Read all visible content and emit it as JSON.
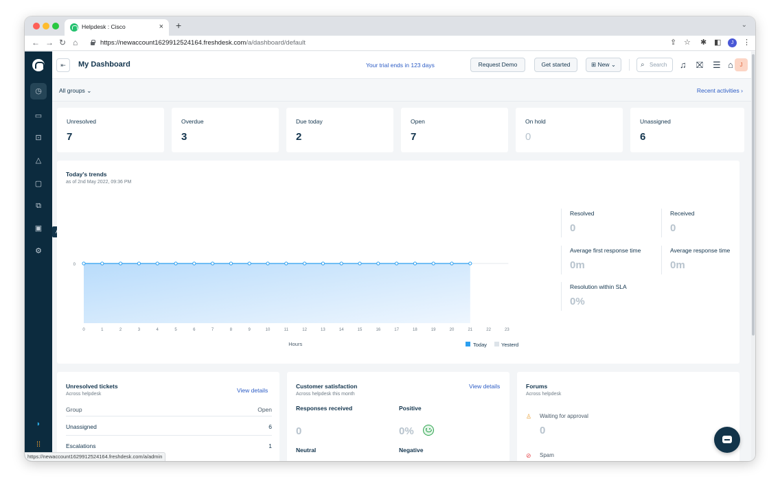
{
  "browser": {
    "tab_title": "Helpdesk : Cisco",
    "tab_close": "×",
    "new_tab": "+",
    "url_host": "https://newaccount1629912524164.freshdesk.com",
    "url_path": "/a/dashboard/default",
    "status_url": "https://newaccount1629912524164.freshdesk.com/a/admin",
    "profile_initial": "J"
  },
  "nav": {
    "tooltip": "Admin"
  },
  "topbar": {
    "title": "My Dashboard",
    "trial": "Your trial ends in 123 days",
    "request_demo": "Request Demo",
    "get_started": "Get started",
    "new": "New",
    "search": "Search",
    "avatar_initial": "J"
  },
  "filter": {
    "groups": "All groups",
    "recent": "Recent activities"
  },
  "stats": [
    {
      "label": "Unresolved",
      "value": "7"
    },
    {
      "label": "Overdue",
      "value": "3"
    },
    {
      "label": "Due today",
      "value": "2"
    },
    {
      "label": "Open",
      "value": "7"
    },
    {
      "label": "On hold",
      "value": "0"
    },
    {
      "label": "Unassigned",
      "value": "6"
    }
  ],
  "trends": {
    "title": "Today's trends",
    "subtitle": "as of 2nd May 2022, 09:36 PM",
    "metrics": [
      {
        "label": "Resolved",
        "value": "0"
      },
      {
        "label": "Received",
        "value": "0"
      },
      {
        "label": "Average first response time",
        "value": "0m"
      },
      {
        "label": "Average response time",
        "value": "0m"
      },
      {
        "label": "Resolution within SLA",
        "value": "0%"
      }
    ]
  },
  "chart_data": {
    "type": "area",
    "x": [
      0,
      1,
      2,
      3,
      4,
      5,
      6,
      7,
      8,
      9,
      10,
      11,
      12,
      13,
      14,
      15,
      16,
      17,
      18,
      19,
      20,
      21,
      22,
      23
    ],
    "series": [
      {
        "name": "Today",
        "x": [
          0,
          1,
          2,
          3,
          4,
          5,
          6,
          7,
          8,
          9,
          10,
          11,
          12,
          13,
          14,
          15,
          16,
          17,
          18,
          19,
          20,
          21
        ],
        "values": [
          0,
          0,
          0,
          0,
          0,
          0,
          0,
          0,
          0,
          0,
          0,
          0,
          0,
          0,
          0,
          0,
          0,
          0,
          0,
          0,
          0,
          0
        ]
      },
      {
        "name": "Yesterday",
        "x": [
          0,
          1,
          2,
          3,
          4,
          5,
          6,
          7,
          8,
          9,
          10,
          11,
          12,
          13,
          14,
          15,
          16,
          17,
          18,
          19,
          20,
          21,
          22,
          23
        ],
        "values": [
          0,
          0,
          0,
          0,
          0,
          0,
          0,
          0,
          0,
          0,
          0,
          0,
          0,
          0,
          0,
          0,
          0,
          0,
          0,
          0,
          0,
          0,
          0,
          0
        ]
      }
    ],
    "xlabel": "Hours",
    "ylabel": "",
    "yticks": [
      "0"
    ],
    "legend": "bottom-right",
    "colors": {
      "today": "#2c9ff0",
      "yesterday": "#dde3e9"
    }
  },
  "unresolved": {
    "title": "Unresolved tickets",
    "subtitle": "Across helpdesk",
    "link": "View details",
    "col_group": "Group",
    "col_open": "Open",
    "rows": [
      {
        "group": "Unassigned",
        "count": "6"
      },
      {
        "group": "Escalations",
        "count": "1"
      }
    ]
  },
  "csat": {
    "title": "Customer satisfaction",
    "subtitle": "Across helpdesk this month",
    "link": "View details",
    "responses_label": "Responses received",
    "responses_value": "0",
    "positive_label": "Positive",
    "positive_value": "0%",
    "neutral_label": "Neutral",
    "negative_label": "Negative"
  },
  "forums": {
    "title": "Forums",
    "subtitle": "Across helpdesk",
    "waiting_label": "Waiting for approval",
    "waiting_value": "0",
    "spam_label": "Spam"
  }
}
